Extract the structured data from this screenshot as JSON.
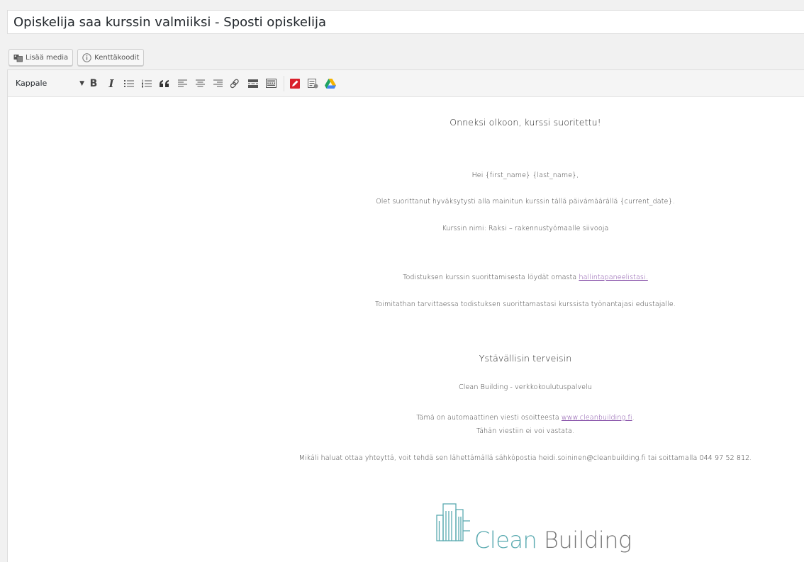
{
  "title": "Opiskelija saa kurssin valmiiksi - Sposti opiskelija",
  "media_buttons": {
    "add_media": "Lisää media",
    "field_codes": "Kenttäkoodit"
  },
  "toolbar": {
    "format": "Kappale",
    "bold": "B",
    "italic": "I"
  },
  "email": {
    "heading": "Onneksi olkoon, kurssi suoritettu!",
    "greeting": "Hei {first_name} {last_name},",
    "completed": "Olet suorittanut hyväksytysti alla mainitun kurssin tällä päivämäärällä {current_date}.",
    "course_name": "Kurssin nimi: Raksi – rakennustyömaalle siivooja",
    "certificate_prefix": "Todistuksen kurssin suorittamisesta löydät omasta ",
    "certificate_link": "hallintapaneelistasi.",
    "deliver": "Toimitathan tarvittaessa todistuksen suorittamastasi kurssista työnantajasi edustajalle.",
    "regards": "Ystävällisin terveisin",
    "sender": "Clean Building - verkkokoulutuspalvelu",
    "auto_prefix": "Tämä on automaattinen viesti osoitteesta ",
    "auto_link": "www.cleanbuilding.fi",
    "auto_suffix": ".",
    "no_reply": "Tähän viestiin ei voi vastata.",
    "contact": "Mikäli haluat ottaa yhteyttä, voit tehdä sen lähettämällä sähköpostia heidi.soininen@cleanbuilding.fi tai soittamalla 044 97 52 812."
  },
  "logo": {
    "word1": "Clean",
    "word2": " Building"
  },
  "colors": {
    "link": "#7b3fa0",
    "logo_teal": "#5aaab0",
    "logo_gray": "#777777",
    "red_icon": "#d9212c"
  }
}
